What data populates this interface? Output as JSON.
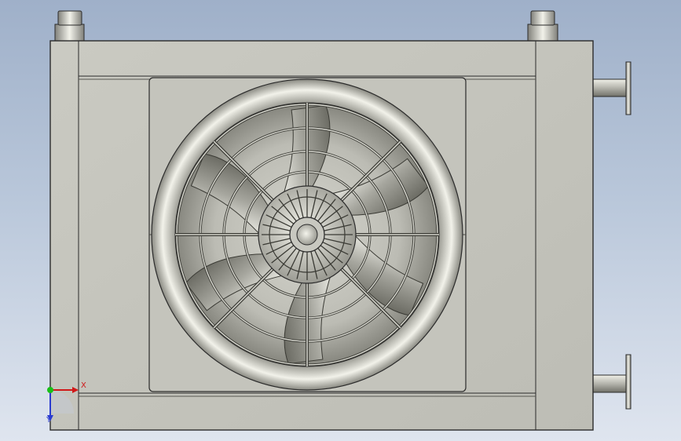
{
  "viewport": {
    "background_top": "#9fb0c9",
    "background_bottom": "#dfe5ef"
  },
  "model": {
    "body_color": "#c3c3bb",
    "edge_color": "#2b2b2b",
    "fan_blade_count": 6,
    "guard_spoke_count": 8,
    "hub_rib_count": 28
  },
  "triad": {
    "x_label": "X",
    "y_label": "Y",
    "x_color": "#d01818",
    "y_color": "#2a3bd0",
    "origin_color": "#18c018"
  }
}
